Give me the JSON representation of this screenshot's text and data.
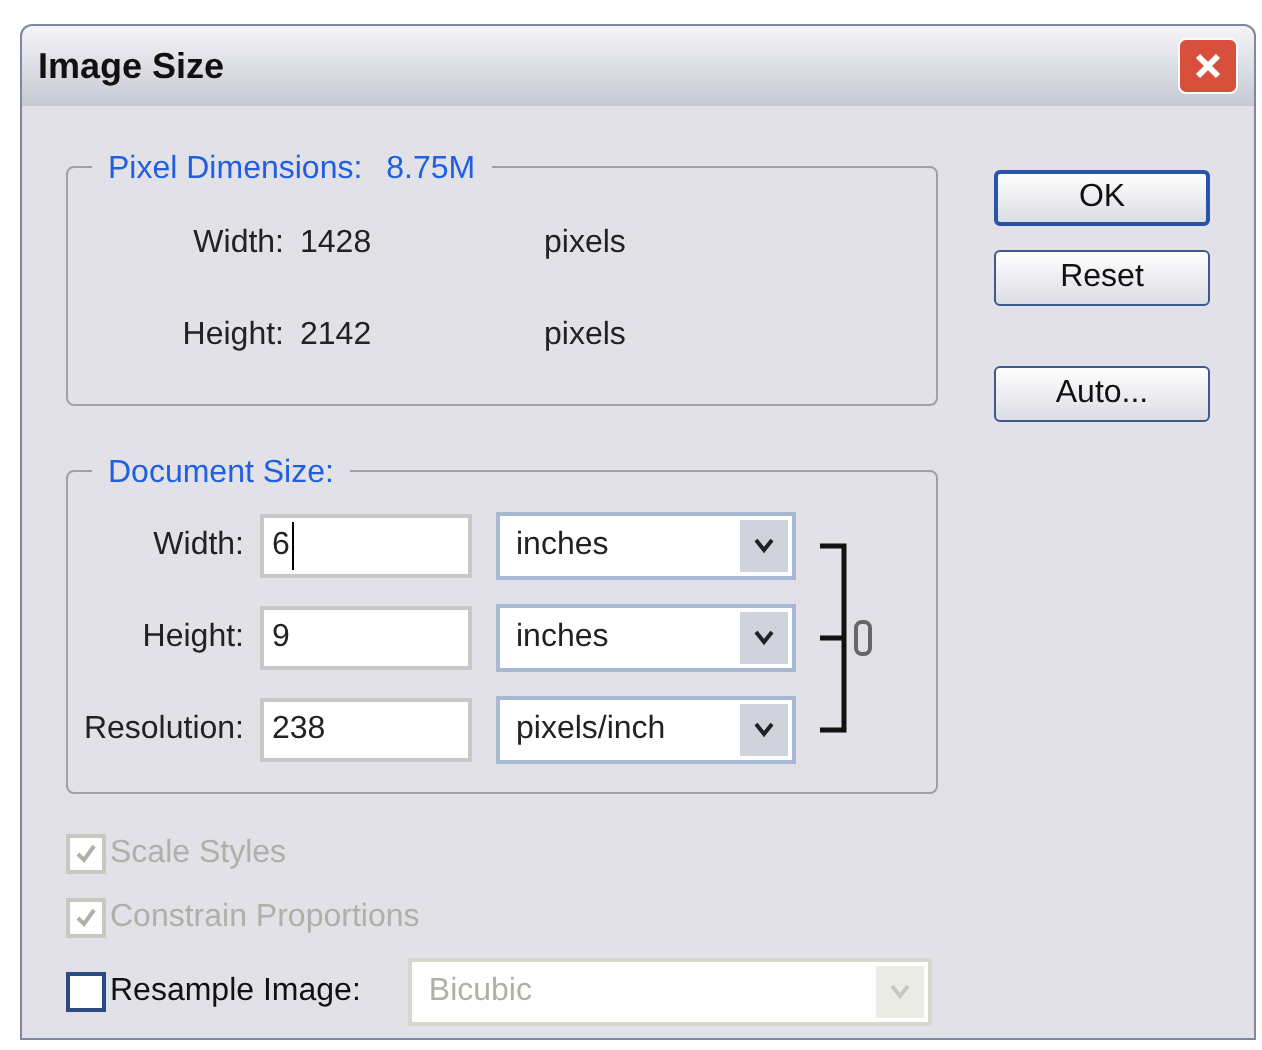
{
  "window": {
    "title": "Image Size"
  },
  "pixel_dimensions": {
    "title": "Pixel Dimensions:",
    "size": "8.75M",
    "rows": [
      {
        "label": "Width:",
        "value": "1428",
        "unit": "pixels"
      },
      {
        "label": "Height:",
        "value": "2142",
        "unit": "pixels"
      }
    ]
  },
  "document_size": {
    "title": "Document Size:",
    "rows": [
      {
        "label": "Width:",
        "value": "6",
        "unit": "inches",
        "focused": true
      },
      {
        "label": "Height:",
        "value": "9",
        "unit": "inches",
        "focused": false
      },
      {
        "label": "Resolution:",
        "value": "238",
        "unit": "pixels/inch",
        "focused": false
      }
    ]
  },
  "buttons": [
    {
      "label": "OK",
      "default": true
    },
    {
      "label": "Reset",
      "default": false
    },
    {
      "label": "Auto...",
      "default": false
    }
  ],
  "options": [
    {
      "label": "Scale Styles",
      "checked": true,
      "disabled": true
    },
    {
      "label": "Constrain Proportions",
      "checked": true,
      "disabled": true
    },
    {
      "label": "Resample Image:",
      "checked": false,
      "disabled": false
    }
  ],
  "resample_method": {
    "value": "Bicubic",
    "disabled": true
  }
}
